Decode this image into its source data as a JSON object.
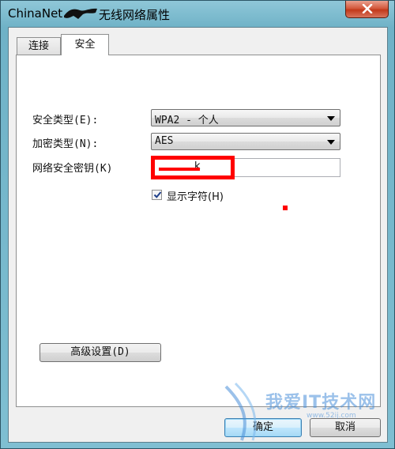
{
  "window": {
    "title_prefix": "ChinaNet",
    "title_suffix": "无线网络属性",
    "close_icon": "close-icon"
  },
  "tabs": [
    {
      "label": "连接",
      "active": false
    },
    {
      "label": "安全",
      "active": true
    }
  ],
  "security": {
    "type_label": "安全类型(E):",
    "type_value": "WPA2 - 个人",
    "encryption_label": "加密类型(N):",
    "encryption_value": "AES",
    "key_label": "网络安全密钥(K)",
    "key_value": "k",
    "show_chars_label": "显示字符(H)",
    "show_chars_checked": true
  },
  "buttons": {
    "advanced": "高级设置(D)",
    "ok": "确定",
    "cancel": "取消"
  },
  "watermark": {
    "text": "我爱IT技术网",
    "url": "www.52ij.com"
  },
  "colors": {
    "annotation_red": "#ff0000",
    "title_gradient": "#7fbfd2",
    "close_red": "#c2391b"
  }
}
